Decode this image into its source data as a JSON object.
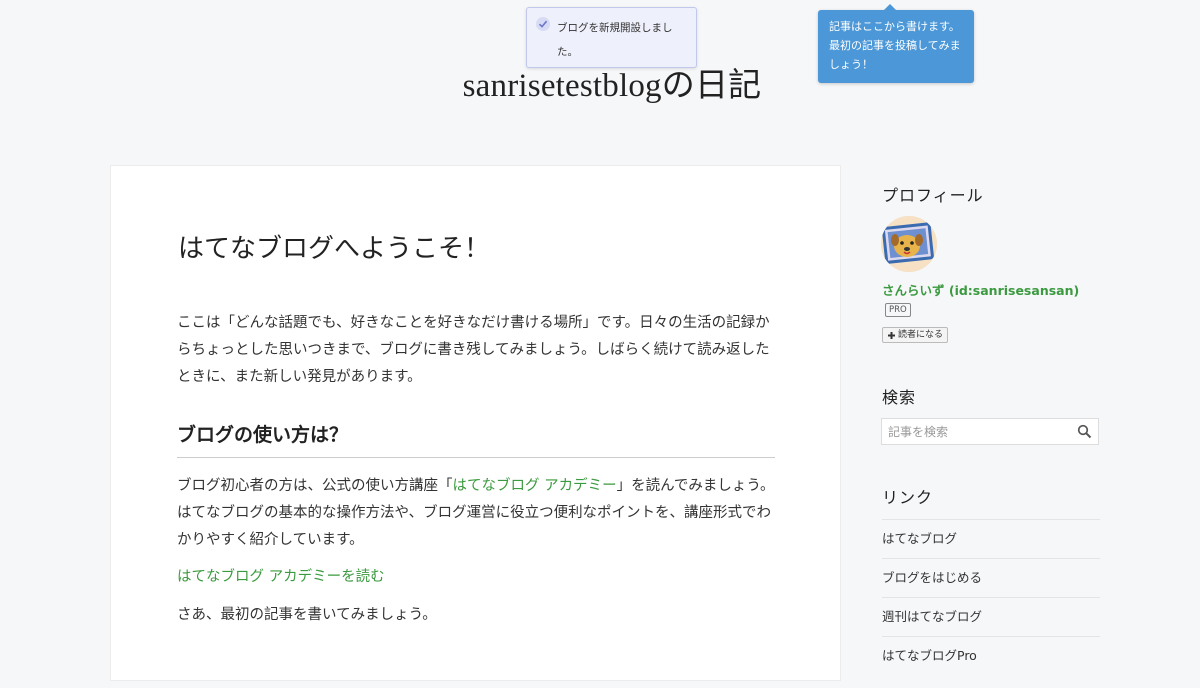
{
  "notification": {
    "message": "ブログを新規開設しました。",
    "icon": "check-icon"
  },
  "tooltip": {
    "text": "記事はここから書けます。最初の記事を投稿してみましょう！"
  },
  "blog": {
    "title": "sanrisetestblogの日記"
  },
  "article": {
    "title": "はてなブログへようこそ！",
    "intro": "ここは「どんな話題でも、好きなことを好きなだけ書ける場所」です。日々の生活の記録からちょっとした思いつきまで、ブログに書き残してみましょう。しばらく続けて読み返したときに、また新しい発見があります。",
    "section_heading": "ブログの使い方は？",
    "p2_before": "ブログ初心者の方は、公式の使い方講座「",
    "p2_link": "はてなブログ アカデミー",
    "p2_after": "」を読んでみましょう。はてなブログの基本的な操作方法や、ブログ運営に役立つ便利なポイントを、講座形式でわかりやすく紹介しています。",
    "academy_link": "はてなブログ アカデミーを読む",
    "closing": "さあ、最初の記事を書いてみましょう。"
  },
  "sidebar": {
    "profile": {
      "title": "プロフィール",
      "username": "さんらいず (id:sanrisesansan)",
      "badge": "PRO",
      "follow_label": "読者になる"
    },
    "search": {
      "title": "検索",
      "placeholder": "記事を検索"
    },
    "links": {
      "title": "リンク",
      "items": [
        {
          "label": "はてなブログ"
        },
        {
          "label": "ブログをはじめる"
        },
        {
          "label": "週刊はてなブログ"
        },
        {
          "label": "はてなブログPro"
        }
      ]
    }
  },
  "colors": {
    "accent_green": "#3b9a3f",
    "tooltip_blue": "#4b97d7",
    "background": "#f6f7f9"
  }
}
